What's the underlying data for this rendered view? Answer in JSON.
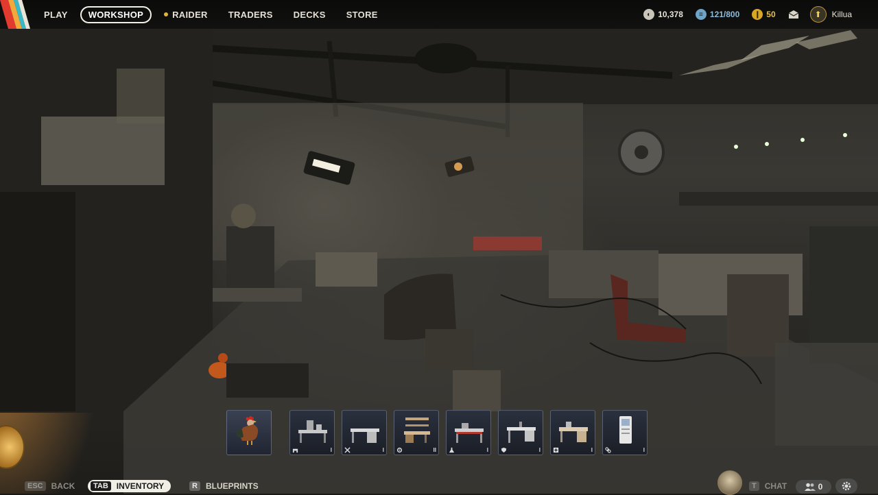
{
  "nav": {
    "items": [
      {
        "label": "PLAY",
        "active": false
      },
      {
        "label": "WORKSHOP",
        "active": true
      },
      {
        "label": "RAIDER",
        "active": false,
        "dot": true
      },
      {
        "label": "TRADERS",
        "active": false
      },
      {
        "label": "DECKS",
        "active": false
      },
      {
        "label": "STORE",
        "active": false
      }
    ]
  },
  "stats": {
    "coins": "10,378",
    "capacity": "121/800",
    "tokens": "50"
  },
  "user": {
    "name": "Killua"
  },
  "hotbar": {
    "slots": [
      {
        "name": "rooster",
        "category_icon": "",
        "level": ""
      },
      {
        "name": "workbench-1",
        "category_icon": "bench-icon",
        "level": "I"
      },
      {
        "name": "workbench-2",
        "category_icon": "tools-icon",
        "level": "I"
      },
      {
        "name": "workbench-3",
        "category_icon": "gear-icon",
        "level": "II"
      },
      {
        "name": "workbench-4",
        "category_icon": "flask-icon",
        "level": "I"
      },
      {
        "name": "workbench-5",
        "category_icon": "shield-icon",
        "level": "I"
      },
      {
        "name": "workbench-6",
        "category_icon": "medkit-icon",
        "level": "I"
      },
      {
        "name": "workbench-7",
        "category_icon": "cross-icon",
        "level": "I"
      }
    ]
  },
  "bottom": {
    "back_key": "ESC",
    "back_label": "BACK",
    "inventory_key": "TAB",
    "inventory_label": "INVENTORY",
    "blueprints_key": "R",
    "blueprints_label": "BLUEPRINTS",
    "chat_key": "T",
    "chat_label": "CHAT",
    "friends_count": "0"
  }
}
